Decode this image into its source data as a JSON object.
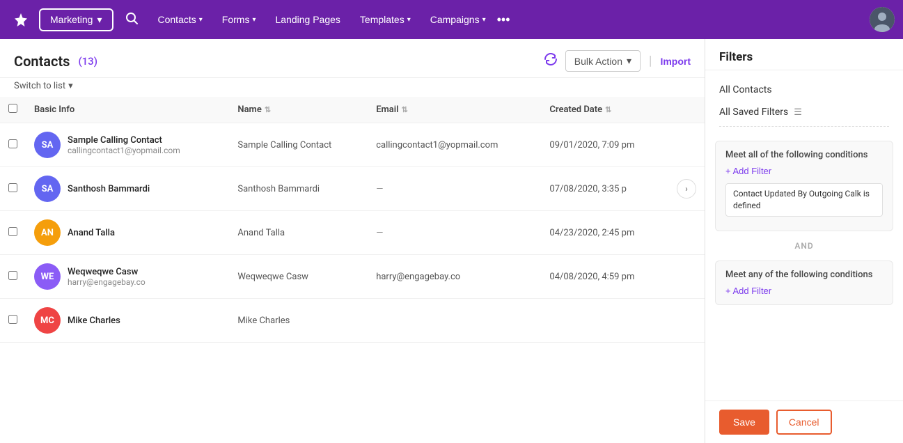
{
  "topnav": {
    "logo_icon": "✦",
    "dropdown_label": "Marketing",
    "search_icon": "🔍",
    "nav_items": [
      {
        "label": "Contacts",
        "has_dropdown": true
      },
      {
        "label": "Forms",
        "has_dropdown": true
      },
      {
        "label": "Landing Pages",
        "has_dropdown": false
      },
      {
        "label": "Templates",
        "has_dropdown": true
      },
      {
        "label": "Campaigns",
        "has_dropdown": true
      }
    ],
    "more_icon": "•••"
  },
  "contacts": {
    "title": "Contacts",
    "count": "(13)",
    "switch_to_list": "Switch to list",
    "bulk_action_label": "Bulk Action",
    "import_label": "Import",
    "columns": [
      {
        "label": "Basic Info",
        "sortable": false
      },
      {
        "label": "Name",
        "sortable": true
      },
      {
        "label": "Email",
        "sortable": true
      },
      {
        "label": "Created Date",
        "sortable": true
      }
    ],
    "rows": [
      {
        "initials": "SA",
        "avatar_color": "#6366f1",
        "name": "Sample Calling Contact",
        "email_sub": "callingcontact1@yopmail.com",
        "name_col": "Sample Calling Contact",
        "email_col": "callingcontact1@yopmail.com",
        "date_col": "09/01/2020, 7:09 pm"
      },
      {
        "initials": "SA",
        "avatar_color": "#6366f1",
        "name": "Santhosh Bammardi",
        "email_sub": "",
        "name_col": "Santhosh Bammardi",
        "email_col": "—",
        "date_col": "07/08/2020, 3:35 p"
      },
      {
        "initials": "AN",
        "avatar_color": "#f59e0b",
        "name": "Anand Talla",
        "email_sub": "",
        "name_col": "Anand Talla",
        "email_col": "—",
        "date_col": "04/23/2020, 2:45 pm"
      },
      {
        "initials": "WE",
        "avatar_color": "#8b5cf6",
        "name": "Weqweqwe Casw",
        "email_sub": "harry@engagebay.co",
        "name_col": "Weqweqwe Casw",
        "email_col": "harry@engagebay.co",
        "date_col": "04/08/2020, 4:59 pm"
      },
      {
        "initials": "MC",
        "avatar_color": "#ef4444",
        "name": "Mike Charles",
        "email_sub": "",
        "name_col": "Mike Charles",
        "email_col": "",
        "date_col": ""
      }
    ]
  },
  "filter_panel": {
    "title": "Filters",
    "all_contacts_label": "All Contacts",
    "all_saved_filters_label": "All Saved Filters",
    "condition_block_1": {
      "title": "Meet all of the following conditions",
      "add_filter_label": "+ Add Filter",
      "filter_tag": "Contact Updated By Outgoing Calk is defined"
    },
    "and_label": "AND",
    "condition_block_2": {
      "title": "Meet any of the following conditions",
      "add_filter_label": "+ Add Filter"
    },
    "save_label": "Save",
    "cancel_label": "Cancel"
  }
}
